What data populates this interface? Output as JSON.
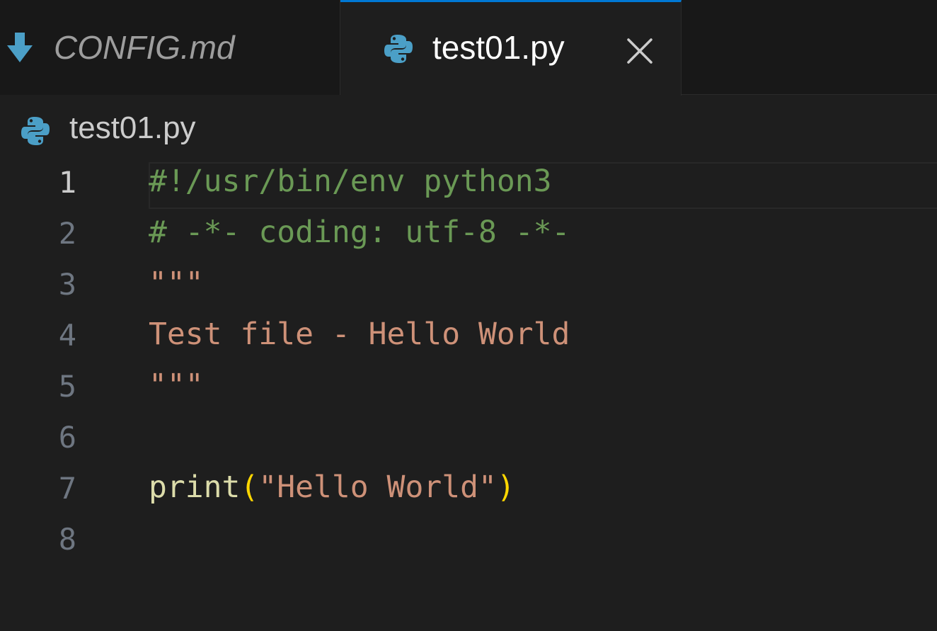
{
  "tabs": [
    {
      "label": "CONFIG.md",
      "icon": "markdown-arrow-icon",
      "active": false
    },
    {
      "label": "test01.py",
      "icon": "python-icon",
      "active": true
    }
  ],
  "breadcrumb": {
    "file": "test01.py",
    "icon": "python-icon"
  },
  "editor": {
    "current_line": 1,
    "lines": [
      {
        "number": "1",
        "tokens": [
          {
            "text": "#!/usr/bin/env python3",
            "kind": "comment"
          }
        ]
      },
      {
        "number": "2",
        "tokens": [
          {
            "text": "# -*- coding: utf-8 -*-",
            "kind": "comment"
          }
        ]
      },
      {
        "number": "3",
        "tokens": [
          {
            "text": "\"\"\"",
            "kind": "string"
          }
        ]
      },
      {
        "number": "4",
        "tokens": [
          {
            "text": "Test file - Hello World",
            "kind": "string"
          }
        ]
      },
      {
        "number": "5",
        "tokens": [
          {
            "text": "\"\"\"",
            "kind": "string"
          }
        ]
      },
      {
        "number": "6",
        "tokens": []
      },
      {
        "number": "7",
        "tokens": [
          {
            "text": "print",
            "kind": "func"
          },
          {
            "text": "(",
            "kind": "paren"
          },
          {
            "text": "\"Hello World\"",
            "kind": "string"
          },
          {
            "text": ")",
            "kind": "paren"
          }
        ]
      },
      {
        "number": "8",
        "tokens": []
      }
    ]
  },
  "colors": {
    "background": "#1e1e1e",
    "tab_bar": "#181818",
    "active_tab_border": "#0078d4",
    "comment": "#6a9955",
    "string": "#ce9178",
    "function": "#dcdcaa",
    "bracket": "#ffd700",
    "python_blue": "#3e8fb0",
    "python_icon_color": "#4b9fc7"
  }
}
